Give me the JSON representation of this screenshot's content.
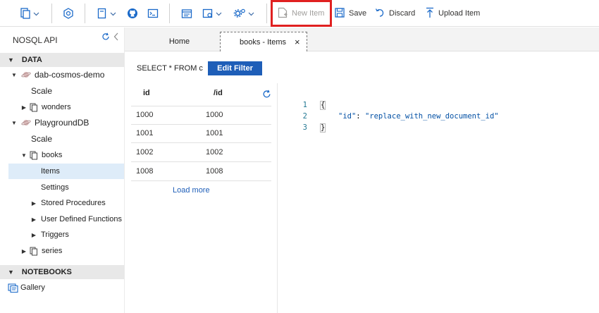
{
  "toolbar": {
    "icons": [
      "new-container-icon",
      "cosmos-icon",
      "new-notebook-icon",
      "github-icon",
      "terminal-icon",
      "settings-panel-icon",
      "open-query-icon",
      "gear-icon"
    ],
    "new_item_label": "New Item",
    "save_label": "Save",
    "discard_label": "Discard",
    "upload_item_label": "Upload Item",
    "highlight_color": "#e02020"
  },
  "sidebar": {
    "api_title": "NOSQL API",
    "data_section": "DATA",
    "notebooks_section": "NOTEBOOKS",
    "databases": [
      {
        "name": "dab-cosmos-demo",
        "scale": "Scale",
        "containers": [
          {
            "name": "wonders"
          }
        ]
      },
      {
        "name": "PlaygroundDB",
        "scale": "Scale",
        "containers": [
          {
            "name": "books",
            "items": "Items",
            "settings": "Settings",
            "stored_procedures": "Stored Procedures",
            "udfs": "User Defined Functions",
            "triggers": "Triggers"
          },
          {
            "name": "series"
          }
        ]
      }
    ],
    "gallery": "Gallery"
  },
  "tabs": {
    "home": "Home",
    "books_items": "books - Items",
    "close_glyph": "×"
  },
  "query": {
    "text": "SELECT * FROM c",
    "edit_filter": "Edit Filter"
  },
  "table": {
    "headers": [
      "id",
      "/id"
    ],
    "rows": [
      [
        "1000",
        "1000"
      ],
      [
        "1001",
        "1001"
      ],
      [
        "1002",
        "1002"
      ],
      [
        "1008",
        "1008"
      ]
    ],
    "load_more": "Load more"
  },
  "editor": {
    "line_numbers": [
      "1",
      "2",
      "3"
    ],
    "open_brace": "{",
    "key": "\"id\"",
    "colon": ": ",
    "value": "\"replace_with_new_document_id\"",
    "close_brace": "}"
  },
  "colors": {
    "accent": "#1e5eb8",
    "selected_row": "#deecf9",
    "section_header": "#e8e8e8"
  }
}
